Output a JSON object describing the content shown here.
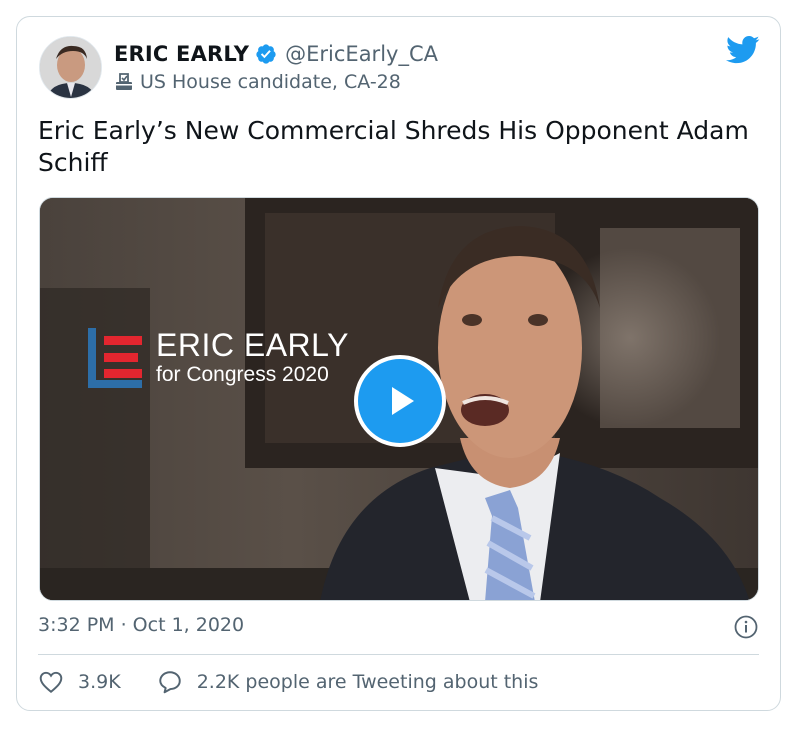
{
  "author": {
    "name": "ERIC EARLY",
    "handle": "@EricEarly_CA",
    "label": "US House candidate, CA-28"
  },
  "tweet": {
    "text": "Eric Early’s New Commercial Shreds His Opponent Adam Schiff",
    "timestamp": "3:32 PM · Oct 1, 2020"
  },
  "video": {
    "logo_line1": "ERIC EARLY",
    "logo_line2": "for Congress 2020"
  },
  "engagement": {
    "likes": "3.9K",
    "conversation": "2.2K people are Tweeting about this"
  },
  "icons": {
    "verified": "verified-badge-icon",
    "label": "ballot-box-icon",
    "brand": "twitter-bird-icon",
    "play": "play-icon",
    "info": "info-icon",
    "like": "heart-icon",
    "reply": "speech-bubble-icon"
  },
  "colors": {
    "accent": "#1d9bf0",
    "text": "#0f1419",
    "muted": "#536471",
    "border": "#cfd9de",
    "logo_red": "#e3262f",
    "logo_blue": "#2d6ea8"
  }
}
